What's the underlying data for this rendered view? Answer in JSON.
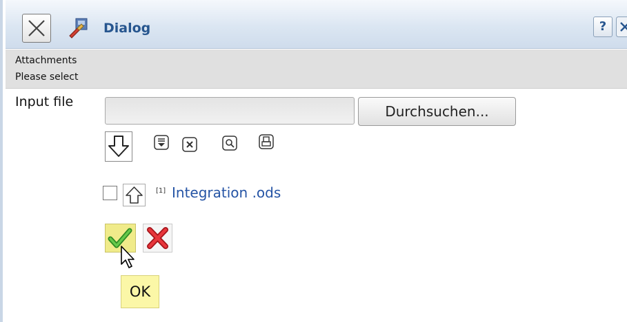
{
  "window": {
    "title": "Dialog",
    "help_label": "?"
  },
  "info": {
    "heading": "Attachments",
    "instruction": "Please select"
  },
  "form": {
    "input_label": "Input file",
    "file_value": "",
    "browse_label": "Durchsuchen..."
  },
  "attachments": [
    {
      "footnote": "[1]",
      "name": "Integration .ods",
      "checked": false
    }
  ],
  "actions": {
    "ok_tooltip": "OK"
  },
  "colors": {
    "title_text": "#27568f",
    "link": "#2554a5",
    "ok_background": "#f0eb8a",
    "tooltip_background": "#fbf7a7",
    "cancel_red": "#d9252b",
    "confirm_green": "#3aa62c"
  },
  "icons": {
    "close": "close-icon",
    "app": "app-icon",
    "help": "help-icon",
    "download": "download-arrow-icon",
    "scroll_bottom": "scroll-to-bottom-icon",
    "remove": "remove-icon",
    "search": "search-icon",
    "print": "print-icon",
    "move_up": "up-arrow-icon",
    "confirm": "checkmark-icon",
    "cancel": "cancel-x-icon"
  }
}
